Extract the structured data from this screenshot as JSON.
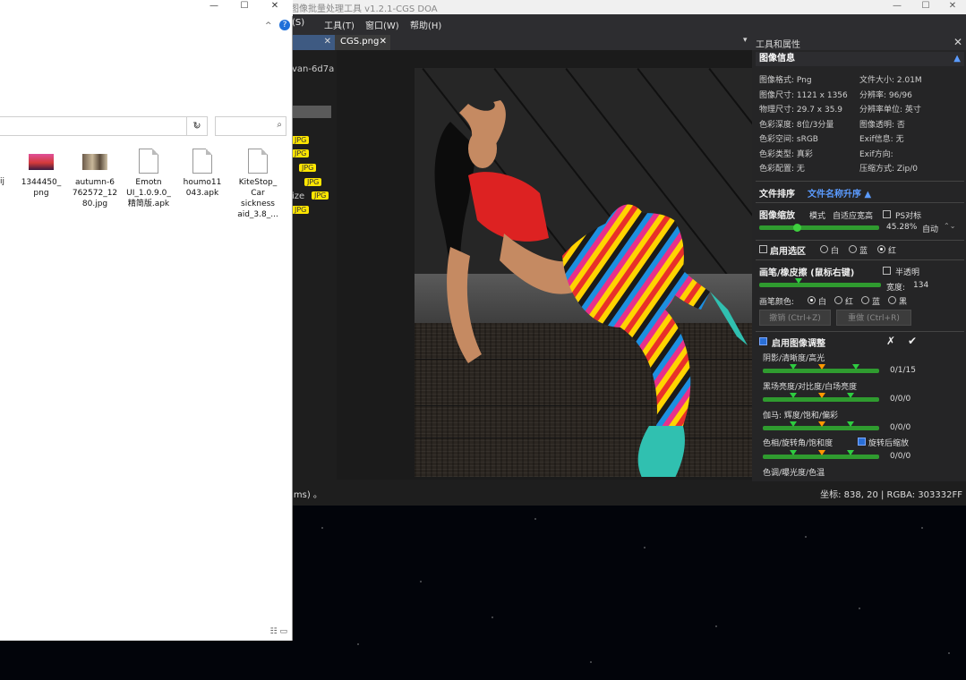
{
  "app": {
    "title": "图像批量处理工具 v1.2.1-CGS DOA",
    "menu": [
      "(S)",
      "工具(T)",
      "窗口(W)",
      "帮助(H)"
    ],
    "tabs": [
      {
        "label": ""
      },
      {
        "label": "CGS.png"
      }
    ],
    "left_strip": {
      "partial_name": "van-6d7a",
      "size_label": "ize"
    },
    "badges": [
      "JPG",
      "JPG",
      "JPG",
      "JPG",
      "JPG",
      "JPG"
    ],
    "status_left": "(ms) 。",
    "status_coord": "坐标: 838, 20 | RGBA: 303332FF"
  },
  "panel": {
    "title": "工具和属性",
    "image_info": {
      "header": "图像信息",
      "rows": [
        {
          "k1": "图像格式: Png",
          "k2": "文件大小: 2.01M"
        },
        {
          "k1": "图像尺寸: 1121 x 1356",
          "k2": "分辨率: 96/96"
        },
        {
          "k1": "物理尺寸: 29.7 x 35.9",
          "k2": "分辨率单位: 英寸"
        },
        {
          "k1": "色彩深度: 8位/3分量",
          "k2": "图像透明: 否"
        },
        {
          "k1": "色彩空间: sRGB",
          "k2": "Exif信息: 无"
        },
        {
          "k1": "色彩类型: 真彩",
          "k2": "Exif方向:"
        },
        {
          "k1": "色彩配置: 无",
          "k2": "压缩方式: Zip/0"
        }
      ]
    },
    "sort": {
      "label": "文件排序",
      "value": "文件名称升序 ▲"
    },
    "zoom": {
      "label": "图像缩放",
      "mode": "模式",
      "fit": "自适应宽高",
      "ps": "PS对标",
      "percent": "45.28%",
      "auto": "自动",
      "level": 0.28
    },
    "selection": {
      "label": "启用选区",
      "options": [
        "白",
        "蓝",
        "红"
      ],
      "selected": 2
    },
    "brush": {
      "label": "画笔/橡皮擦 (鼠标右键)",
      "translucent": "半透明",
      "width_label": "宽度:",
      "width_value": "134",
      "color_label": "画笔颜色:",
      "colors": [
        "白",
        "红",
        "蓝",
        "黑"
      ],
      "selected_color": 0,
      "undo": "撤销 (Ctrl+Z)",
      "redo": "重做 (Ctrl+R)"
    },
    "adjust": {
      "label": "启用图像调整",
      "cancel_icon": "✗",
      "apply_icon": "✔",
      "groups": [
        {
          "label": "阴影/清晰度/高光",
          "value": "0/1/15"
        },
        {
          "label": "黑场亮度/对比度/白场亮度",
          "value": "0/0/0"
        },
        {
          "label": "伽马: 辉度/饱和/偏彩",
          "value": "0/0/0"
        },
        {
          "label": "色相/旋转角/饱和度",
          "value": "0/0/0",
          "extra": "旋转后缩放"
        },
        {
          "label": "色调/曝光度/色温",
          "value": ""
        }
      ]
    }
  },
  "explorer": {
    "ribbon_toggle": "^",
    "help": "?",
    "addr_dropdown": "⌄",
    "refresh": "↻",
    "search_icon": "⌕",
    "files": [
      {
        "name": "1344450_\npng",
        "kind": "image-sunset"
      },
      {
        "name": "autumn-6\n762572_12\n80.jpg",
        "kind": "image-autumn"
      },
      {
        "name": "Emotn\nUI_1.0.9.0_\n精简版.apk",
        "kind": "doc"
      },
      {
        "name": "houmo11\n043.apk",
        "kind": "doc"
      },
      {
        "name": "KiteStop_\nCar\nsickness\naid_3.8_...",
        "kind": "doc"
      }
    ],
    "partial_left": "ij",
    "view_icons": "☷ ▭"
  },
  "colors": {
    "accent": "#5b9bff",
    "slider": "#2f9b2f",
    "badge": "#ffe600",
    "orange": "#ff9800"
  }
}
